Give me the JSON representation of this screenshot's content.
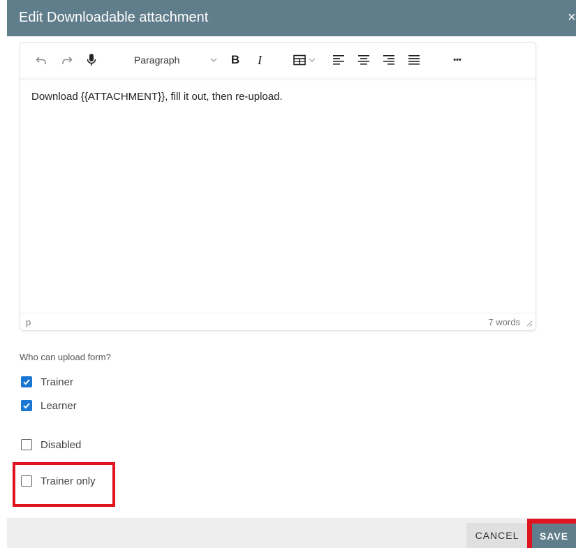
{
  "dialog": {
    "title": "Edit Downloadable attachment",
    "close_glyph": "×"
  },
  "editor": {
    "toolbar": {
      "icons": [
        "undo-icon",
        "redo-icon",
        "microphone-icon",
        "bold-icon",
        "italic-icon",
        "table-icon",
        "align-left-icon",
        "align-center-icon",
        "align-right-icon",
        "justify-icon",
        "more-icon"
      ],
      "format_select": "Paragraph",
      "bold_glyph": "B",
      "italic_glyph": "I",
      "more_glyph": "•••"
    },
    "content": "Download {{ATTACHMENT}}, fill it out, then re-upload.",
    "status_path": "p",
    "word_count": "7 words"
  },
  "form": {
    "question": "Who can upload form?",
    "options": [
      {
        "label": "Trainer",
        "checked": true
      },
      {
        "label": "Learner",
        "checked": true
      },
      {
        "label": "Disabled",
        "checked": false
      },
      {
        "label": "Trainer only",
        "checked": false
      }
    ]
  },
  "footer": {
    "cancel_label": "CANCEL",
    "save_label": "SAVE"
  },
  "colors": {
    "header": "#607d8b",
    "checkbox_checked": "#1976d2",
    "highlight": "#e0141e",
    "footer_bg": "#eeeeee"
  }
}
